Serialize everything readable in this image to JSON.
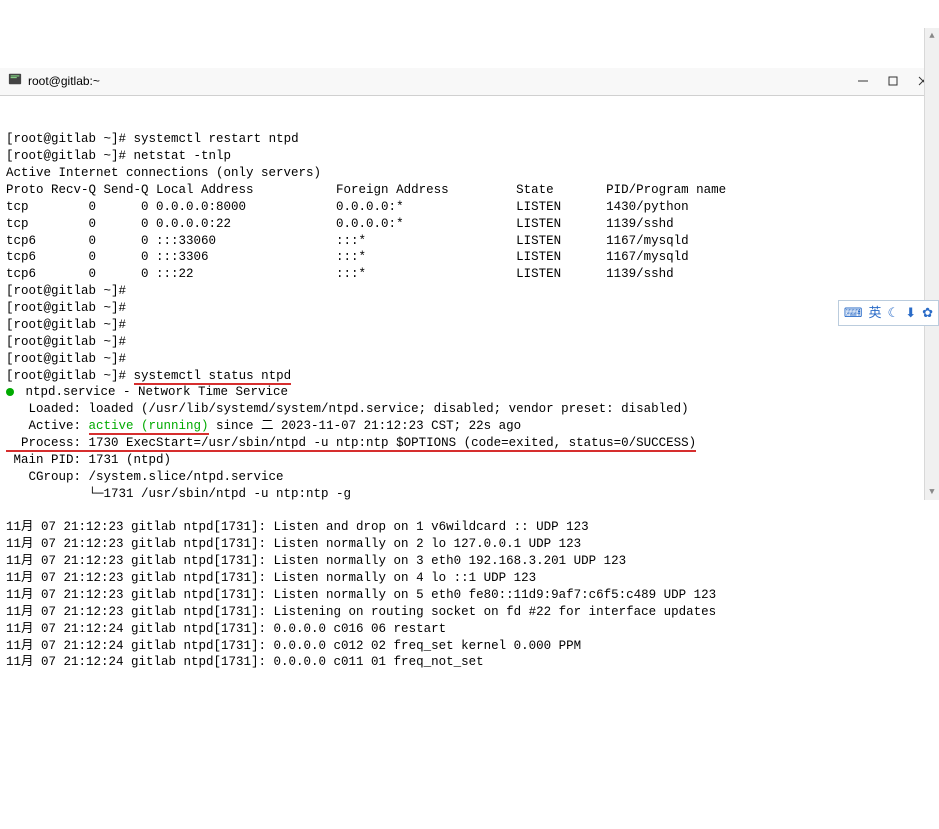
{
  "titlebar": {
    "title": "root@gitlab:~"
  },
  "term": {
    "prompt": "[root@gitlab ~]#",
    "cmd_restart": "systemctl restart ntpd",
    "cmd_netstat": "netstat -tnlp",
    "netstat_header1": "Active Internet connections (only servers)",
    "netstat_columns": "Proto Recv-Q Send-Q Local Address           Foreign Address         State       PID/Program name",
    "netstat_rows": [
      "tcp        0      0 0.0.0.0:8000            0.0.0.0:*               LISTEN      1430/python",
      "tcp        0      0 0.0.0.0:22              0.0.0.0:*               LISTEN      1139/sshd",
      "tcp6       0      0 :::33060                :::*                    LISTEN      1167/mysqld",
      "tcp6       0      0 :::3306                 :::*                    LISTEN      1167/mysqld",
      "tcp6       0      0 :::22                   :::*                    LISTEN      1139/sshd"
    ],
    "cmd_status": "systemctl status ntpd",
    "status_service_line": " ntpd.service - Network Time Service",
    "status_loaded": "   Loaded: loaded (/usr/lib/systemd/system/ntpd.service; disabled; vendor preset: disabled)",
    "status_active_prefix": "   Active: ",
    "status_active_state": "active (running)",
    "status_active_suffix": " since 二 2023-11-07 21:12:23 CST; 22s ago",
    "status_process": "  Process: 1730 ExecStart=/usr/sbin/ntpd -u ntp:ntp $OPTIONS (code=exited, status=0/SUCCESS)",
    "status_mainpid": " Main PID: 1731 (ntpd)",
    "status_cgroup1": "   CGroup: /system.slice/ntpd.service",
    "status_cgroup2": "           └─1731 /usr/sbin/ntpd -u ntp:ntp -g",
    "log_lines": [
      "11月 07 21:12:23 gitlab ntpd[1731]: Listen and drop on 1 v6wildcard :: UDP 123",
      "11月 07 21:12:23 gitlab ntpd[1731]: Listen normally on 2 lo 127.0.0.1 UDP 123",
      "11月 07 21:12:23 gitlab ntpd[1731]: Listen normally on 3 eth0 192.168.3.201 UDP 123",
      "11月 07 21:12:23 gitlab ntpd[1731]: Listen normally on 4 lo ::1 UDP 123",
      "11月 07 21:12:23 gitlab ntpd[1731]: Listen normally on 5 eth0 fe80::11d9:9af7:c6f5:c489 UDP 123",
      "11月 07 21:12:23 gitlab ntpd[1731]: Listening on routing socket on fd #22 for interface updates",
      "11月 07 21:12:24 gitlab ntpd[1731]: 0.0.0.0 c016 06 restart",
      "11月 07 21:12:24 gitlab ntpd[1731]: 0.0.0.0 c012 02 freq_set kernel 0.000 PPM",
      "11月 07 21:12:24 gitlab ntpd[1731]: 0.0.0.0 c011 01 freq_not_set"
    ]
  },
  "toolbar": {
    "ime": "英"
  }
}
